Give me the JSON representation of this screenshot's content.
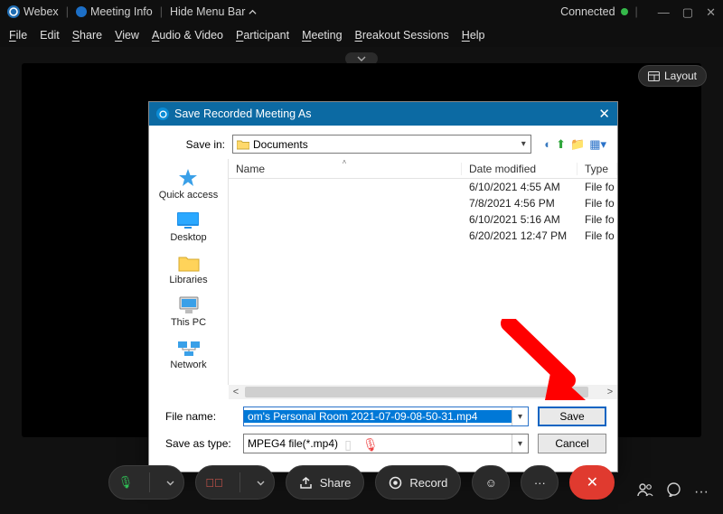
{
  "topbar": {
    "app_name": "Webex",
    "meeting_info": "Meeting Info",
    "hide_menu": "Hide Menu Bar",
    "connected": "Connected"
  },
  "menu": {
    "file": "File",
    "edit": "Edit",
    "share": "Share",
    "view": "View",
    "audio_video": "Audio & Video",
    "participant": "Participant",
    "meeting": "Meeting",
    "breakout": "Breakout Sessions",
    "help": "Help"
  },
  "layout_btn": "Layout",
  "dialog": {
    "title": "Save Recorded Meeting As",
    "save_in_label": "Save in:",
    "save_in_value": "Documents",
    "columns": {
      "name": "Name",
      "date": "Date modified",
      "type": "Type"
    },
    "rows": [
      {
        "name": "",
        "date": "6/10/2021 4:55 AM",
        "type": "File fo"
      },
      {
        "name": "",
        "date": "7/8/2021 4:56 PM",
        "type": "File fo"
      },
      {
        "name": "",
        "date": "6/10/2021 5:16 AM",
        "type": "File fo"
      },
      {
        "name": "",
        "date": "6/20/2021 12:47 PM",
        "type": "File fo"
      }
    ],
    "sidebar": [
      "Quick access",
      "Desktop",
      "Libraries",
      "This PC",
      "Network"
    ],
    "file_name_label": "File name:",
    "file_name_value": "om's Personal Room 2021-07-09-08-50-31.mp4",
    "save_type_label": "Save as type:",
    "save_type_value": "MPEG4 file(*.mp4)",
    "save_btn": "Save",
    "cancel_btn": "Cancel"
  },
  "controls": {
    "share": "Share",
    "record": "Record"
  }
}
